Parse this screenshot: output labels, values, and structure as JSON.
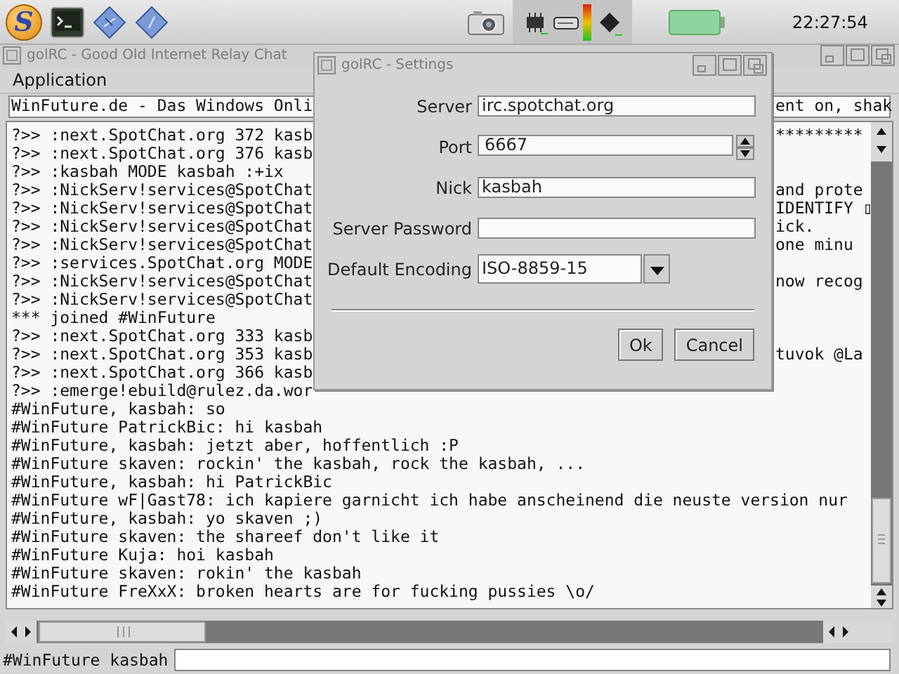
{
  "panel": {
    "logo": "S",
    "clock": "22:27:54"
  },
  "main_window": {
    "title": "golRC - Good Old Internet Relay Chat",
    "menu": [
      "Application"
    ],
    "topic": {
      "text": "WinFuture.de - Das Windows Onli",
      "right": "ent on, shak"
    },
    "log": [
      {
        "text": "?>> :next.SpotChat.org 372 kasb",
        "right": "*********"
      },
      {
        "text": "?>> :next.SpotChat.org 376 kasb"
      },
      {
        "text": "?>> :kasbah MODE kasbah :+ix"
      },
      {
        "text": "?>> :NickServ!services@SpotChat",
        "right": "and prote"
      },
      {
        "text": "?>> :NickServ!services@SpotChat",
        "right": "IDENTIFY ▯"
      },
      {
        "text": "?>> :NickServ!services@SpotChat",
        "right": "ick."
      },
      {
        "text": "?>> :NickServ!services@SpotChat",
        "right": "one minu"
      },
      {
        "text": "?>> :services.SpotChat.org MODE"
      },
      {
        "text": "?>> :NickServ!services@SpotChat",
        "right": "now recog"
      },
      {
        "text": "?>> :NickServ!services@SpotChat"
      },
      {
        "text": "*** joined #WinFuture"
      },
      {
        "text": "?>> :next.SpotChat.org 333 kasb"
      },
      {
        "text": "?>> :next.SpotChat.org 353 kasb",
        "right": "tuvok @La"
      },
      {
        "text": "?>> :next.SpotChat.org 366 kasb"
      },
      {
        "text": "?>> :emerge!ebuild@rulez.da.wor"
      },
      {
        "text": "#WinFuture, kasbah: so"
      },
      {
        "text": "#WinFuture PatrickBic: hi kasbah"
      },
      {
        "text": "#WinFuture, kasbah: jetzt aber, hoffentlich :P"
      },
      {
        "text": "#WinFuture skaven: rockin' the kasbah, rock the kasbah, ..."
      },
      {
        "text": "#WinFuture, kasbah: hi PatrickBic"
      },
      {
        "text": "#WinFuture wF|Gast78: ich kapiere garnicht ich habe anscheinend die neuste version nur"
      },
      {
        "text": "#WinFuture, kasbah: yo skaven ;)"
      },
      {
        "text": "#WinFuture skaven: the shareef don't like it"
      },
      {
        "text": "#WinFuture Kuja: hoi kasbah"
      },
      {
        "text": "#WinFuture skaven: rokin' the kasbah"
      },
      {
        "text": "#WinFuture FreXxX: broken hearts are for fucking pussies \\o/"
      }
    ],
    "channel_label": "#WinFuture kasbah"
  },
  "dialog": {
    "title": "golRC - Settings",
    "fields": [
      {
        "label": "Server",
        "value": "irc.spotchat.org",
        "kind": "text"
      },
      {
        "label": "Port",
        "value": "6667",
        "kind": "spin"
      },
      {
        "label": "Nick",
        "value": "kasbah",
        "kind": "text"
      },
      {
        "label": "Server Password",
        "kind": "text"
      },
      {
        "label": "Default Encoding",
        "value": "ISO-8859-15",
        "kind": "combo"
      }
    ],
    "buttons": [
      "Ok",
      "Cancel"
    ]
  }
}
